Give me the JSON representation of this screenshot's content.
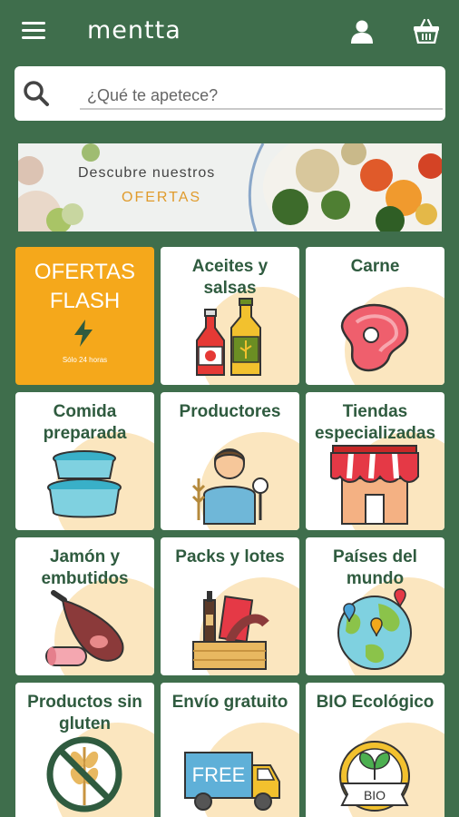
{
  "header": {
    "logo_text": "mentta",
    "icons": [
      "menu-icon",
      "user-icon",
      "basket-icon"
    ]
  },
  "search": {
    "placeholder": "¿Qué te apetece?"
  },
  "banner": {
    "line1": "Descubre nuestros",
    "line2": "OFERTAS"
  },
  "flash": {
    "line1": "OFERTAS",
    "line2": "FLASH",
    "subtitle": "Sólo 24 horas"
  },
  "categories": [
    {
      "label": "Aceites y salsas"
    },
    {
      "label": "Carne"
    },
    {
      "label": "Comida preparada"
    },
    {
      "label": "Productores"
    },
    {
      "label": "Tiendas especializadas"
    },
    {
      "label": "Jamón y embutidos"
    },
    {
      "label": "Packs y lotes"
    },
    {
      "label": "Países del mundo"
    },
    {
      "label": "Productos sin gluten"
    },
    {
      "label": "Envío gratuito"
    },
    {
      "label": "BIO Ecológico"
    }
  ],
  "icon_texts": {
    "free": "FREE",
    "bio": "BIO"
  },
  "colors": {
    "background": "#3f6e4c",
    "tile_label": "#2f5b3f",
    "flash_orange": "#f5a81b",
    "blob": "#fbe6bf"
  }
}
